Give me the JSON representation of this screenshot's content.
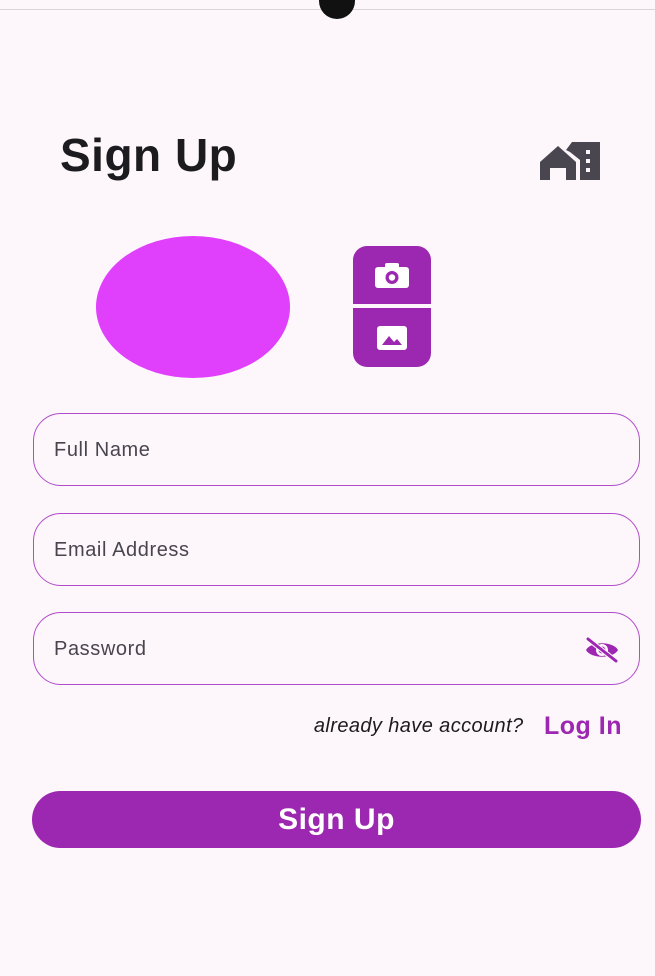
{
  "header": {
    "title": "Sign Up",
    "home_icon": "home-work-icon"
  },
  "profile": {
    "avatar_color": "#e040fb",
    "camera_icon": "camera-icon",
    "gallery_icon": "image-icon"
  },
  "form": {
    "full_name": {
      "placeholder": "Full Name",
      "value": ""
    },
    "email": {
      "placeholder": "Email Address",
      "value": ""
    },
    "password": {
      "placeholder": "Password",
      "value": "",
      "toggle_icon": "visibility-off-icon"
    }
  },
  "login": {
    "prompt": "already have account?",
    "link_label": "Log In"
  },
  "submit": {
    "label": "Sign Up"
  },
  "colors": {
    "primary": "#9c27b0",
    "accent": "#e040fb",
    "background": "#fdf7fb",
    "text": "#1c1b1f"
  }
}
